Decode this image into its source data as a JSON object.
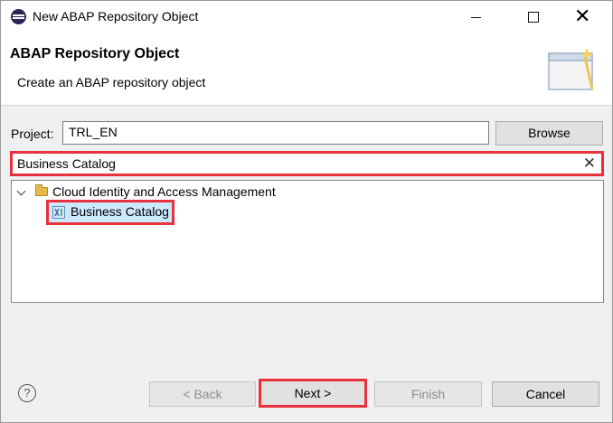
{
  "window": {
    "title": "New ABAP Repository Object",
    "controls": {
      "minimize": "—",
      "maximize": "☐",
      "close": "✕"
    }
  },
  "banner": {
    "title": "ABAP Repository Object",
    "description": "Create an ABAP repository object"
  },
  "project": {
    "label": "Project:",
    "value": "TRL_EN",
    "browse_label": "Browse"
  },
  "filter": {
    "value": "Business Catalog",
    "clear_icon": "✕"
  },
  "tree": {
    "items": [
      {
        "label": "Cloud Identity and Access Management",
        "icon": "folder-open-icon",
        "expanded": true
      },
      {
        "label": "Business Catalog",
        "icon": "business-catalog-icon",
        "selected": true
      }
    ]
  },
  "footer": {
    "help_icon": "?",
    "back_label": "< Back",
    "next_label": "Next >",
    "finish_label": "Finish",
    "cancel_label": "Cancel"
  },
  "colors": {
    "highlight": "#e8313b",
    "selection": "#cce8ff"
  }
}
